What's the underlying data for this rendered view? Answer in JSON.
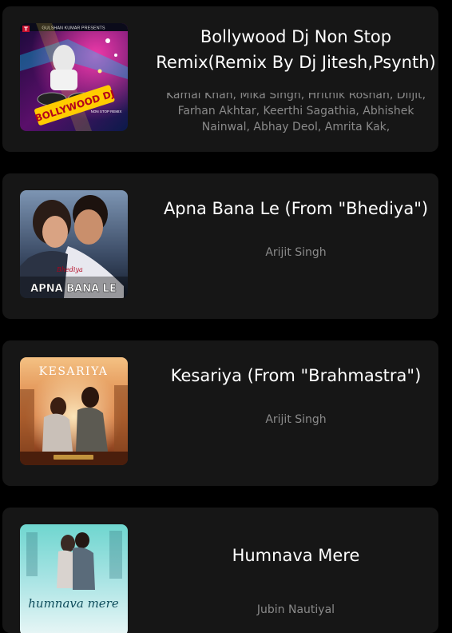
{
  "songs": [
    {
      "title": "Bollywood Dj Non Stop Remix(Remix By Dj Jitesh,Psynth)",
      "artists": "Kamal Khan, Mika Singh, Hrithik Roshan, Diljit, Farhan Akhtar, Keerthi Sagathia, Abhishek Nainwal, Abhay Deol, Amrita Kak,",
      "cover": {
        "header_text": "GULSHAN KUMAR PRESENTS",
        "logo_text": "BOLLYWOOD DJ",
        "sub_text": "NON STOP REMIX",
        "label_mark": "T",
        "art": "dj-turntable-neon-cover"
      }
    },
    {
      "title": "Apna Bana Le (From \"Bhediya\")",
      "artists": "Arijit Singh",
      "cover": {
        "caption_text": "APNA BANA LE",
        "script_text": "Bhediya",
        "art": "couple-portrait-cover"
      }
    },
    {
      "title": "Kesariya (From \"Brahmastra\")",
      "artists": "Arijit Singh",
      "cover": {
        "header_text": "KESARIYA",
        "art": "couple-sitting-sunset-cover"
      }
    },
    {
      "title": "Humnava Mere",
      "artists": "Jubin Nautiyal",
      "cover": {
        "script_text": "humnava mere",
        "art": "couple-winter-cover"
      }
    }
  ],
  "colors": {
    "card_bg": "#161616",
    "page_bg": "#000000",
    "title": "#ffffff",
    "artists": "#8a8a8a"
  }
}
